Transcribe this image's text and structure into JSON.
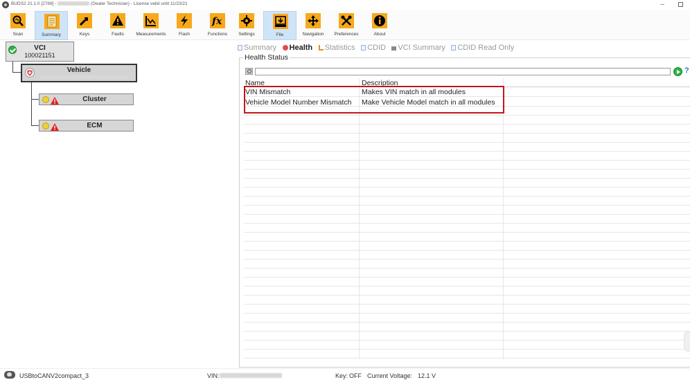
{
  "window": {
    "title_left": "BUDS2  21.1.0 [2769] -",
    "title_role": "(Dealer Technician)",
    "title_license": "- License valid until 11/23/21",
    "minimize_glyph": "–"
  },
  "toolbar": {
    "main": [
      {
        "label": "Scan",
        "icon": "magnifier-scan-icon",
        "selected": false
      },
      {
        "label": "Summary",
        "icon": "document-summary-icon",
        "selected": true
      },
      {
        "label": "Keys",
        "icon": "key-icon",
        "selected": false
      },
      {
        "label": "Faults",
        "icon": "warning-triangle-icon",
        "selected": false
      },
      {
        "label": "Measurements",
        "icon": "measurement-graph-icon",
        "selected": false
      },
      {
        "label": "Flash",
        "icon": "lightning-bolt-icon",
        "selected": false
      },
      {
        "label": "Functions",
        "icon": "fx-function-icon",
        "selected": false
      }
    ],
    "secondary": [
      {
        "label": "Settings",
        "icon": "gear-icon",
        "selected": false
      },
      {
        "label": "File",
        "icon": "download-file-icon",
        "selected": true
      },
      {
        "label": "Navigation",
        "icon": "navigation-arrows-icon",
        "selected": false
      },
      {
        "label": "Preferences",
        "icon": "tools-wrench-icon",
        "selected": false
      },
      {
        "label": "About",
        "icon": "info-icon",
        "selected": false
      }
    ],
    "colors": {
      "icon_bg": "#f7a81b",
      "selected_bg": "#cfe4f7"
    }
  },
  "tree": {
    "vci": {
      "title": "VCI",
      "serial": "100021151",
      "status": "ok"
    },
    "vehicle": {
      "title": "Vehicle"
    },
    "modules": [
      {
        "label": "Cluster",
        "status": "warning"
      },
      {
        "label": "ECM",
        "status": "warning"
      }
    ]
  },
  "tabs": [
    {
      "label": "Summary",
      "active": false,
      "icon": "document-icon"
    },
    {
      "label": "Health",
      "active": true,
      "icon": "shield-health-icon"
    },
    {
      "label": "Statistics",
      "active": false,
      "icon": "bar-stats-icon"
    },
    {
      "label": "CDID",
      "active": false,
      "icon": "document-icon"
    },
    {
      "label": "VCI Summary",
      "active": false,
      "icon": "vci-card-icon"
    },
    {
      "label": "CDID Read Only",
      "active": false,
      "icon": "document-icon"
    }
  ],
  "health": {
    "group_title": "Health Status",
    "search_value": "",
    "columns": {
      "name": "Name",
      "description": "Description"
    },
    "rows": [
      {
        "name": "VIN Mismatch",
        "description": "Makes VIN match in all modules"
      },
      {
        "name": "Vehicle Model Number Mismatch",
        "description": "Make Vehicle Model match in all modules"
      }
    ],
    "highlight_color": "#c0161b"
  },
  "statusbar": {
    "adapter": "USBtoCANV2compact_3",
    "vin_label": "VIN:",
    "key_label": "Key:",
    "key_value": "OFF",
    "voltage_label": "Current Voltage:",
    "voltage_value": "12.1 V"
  }
}
